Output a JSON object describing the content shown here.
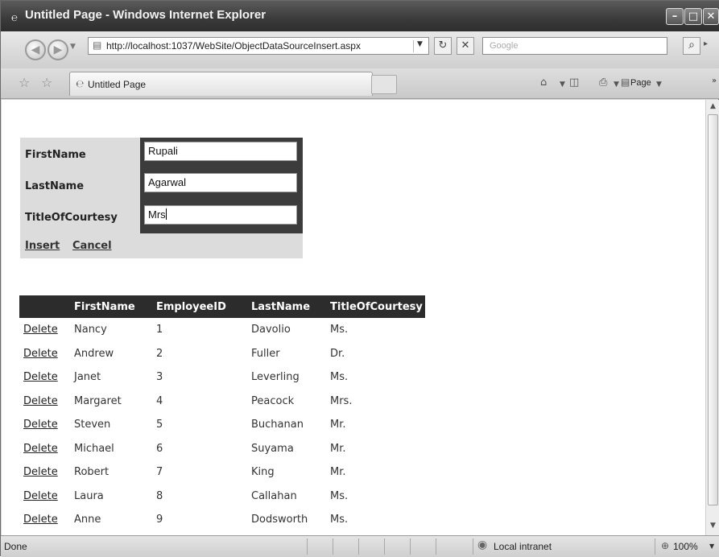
{
  "window": {
    "title": "Untitled Page - Windows Internet Explorer",
    "min_glyph": "–",
    "max_glyph": "□",
    "close_glyph": "✕"
  },
  "navbar": {
    "back_glyph": "◀",
    "forward_glyph": "▶",
    "url": "http://localhost:1037/WebSite/ObjectDataSourceInsert.aspx",
    "refresh_glyph": "↻",
    "stop_glyph": "✕",
    "search_placeholder": "Google",
    "search_glyph": "⌕"
  },
  "tabbar": {
    "tab_title": "Untitled Page",
    "home_glyph": "⌂",
    "feeds_glyph": "◫",
    "print_glyph": "⎙",
    "page_label": "Page"
  },
  "form": {
    "labels": {
      "first": "FirstName",
      "last": "LastName",
      "title": "TitleOfCourtesy"
    },
    "values": {
      "first": "Rupali",
      "last": "Agarwal",
      "title": "Mrs"
    },
    "insert_label": "Insert",
    "cancel_label": "Cancel"
  },
  "grid": {
    "headers": [
      "",
      "FirstName",
      "EmployeeID",
      "LastName",
      "TitleOfCourtesy"
    ],
    "delete_label": "Delete",
    "rows": [
      {
        "first": "Nancy",
        "id": "1",
        "last": "Davolio",
        "title": "Ms."
      },
      {
        "first": "Andrew",
        "id": "2",
        "last": "Fuller",
        "title": "Dr."
      },
      {
        "first": "Janet",
        "id": "3",
        "last": "Leverling",
        "title": "Ms."
      },
      {
        "first": "Margaret",
        "id": "4",
        "last": "Peacock",
        "title": "Mrs."
      },
      {
        "first": "Steven",
        "id": "5",
        "last": "Buchanan",
        "title": "Mr."
      },
      {
        "first": "Michael",
        "id": "6",
        "last": "Suyama",
        "title": "Mr."
      },
      {
        "first": "Robert",
        "id": "7",
        "last": "King",
        "title": "Mr."
      },
      {
        "first": "Laura",
        "id": "8",
        "last": "Callahan",
        "title": "Ms."
      },
      {
        "first": "Anne",
        "id": "9",
        "last": "Dodsworth",
        "title": "Ms."
      }
    ]
  },
  "status": {
    "text": "Done",
    "zone": "Local intranet",
    "zoom": "100%"
  }
}
